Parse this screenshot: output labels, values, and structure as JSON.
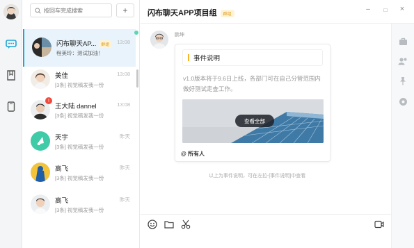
{
  "search": {
    "placeholder": "按回车完成搜索"
  },
  "add_button": "+",
  "conversations": [
    {
      "name": "闪布聊天AP...",
      "tag": "群组",
      "preview": "程美玲：测试加油！",
      "time": "13:08"
    },
    {
      "name": "美佳",
      "preview": "[3条] 视觉稿发我一份",
      "time": "13:08"
    },
    {
      "name": "王大陆 dannel",
      "preview": "[3条] 视觉稿发我一份",
      "time": "13:08",
      "unread": "!"
    },
    {
      "name": "天宇",
      "preview": "[3条] 视觉稿发我一份",
      "time": "昨天"
    },
    {
      "name": "高飞",
      "preview": "[3条] 视觉稿发我一份",
      "time": "昨天"
    },
    {
      "name": "高飞",
      "preview": "[3条] 视觉稿发我一份",
      "time": "昨天"
    }
  ],
  "chat": {
    "title": "闪布聊天APP项目组",
    "title_tag": "群组",
    "sender": "鹏坤",
    "card": {
      "title": "事件说明",
      "body": "v1.0版本将于9.6日上线，各部门可在自己分管范围内做好测试走查工作。",
      "button": "查看全部",
      "footer": "@ 所有人"
    },
    "system_note": "以上为事件说明，可在左拉-[事件说明]中查看"
  },
  "window_controls": {
    "minimize": "–",
    "maximize": "□",
    "close": "×"
  },
  "colors": {
    "accent": "#1aa6d8",
    "active_bg": "#e8f3fb",
    "tag": "#d99a1c",
    "tag_bg": "#fff3d6",
    "unread": "#f04a3e",
    "teal": "#5bd5b5"
  }
}
